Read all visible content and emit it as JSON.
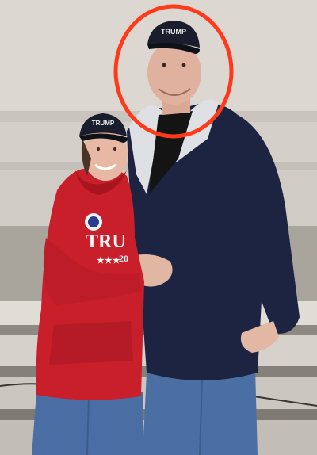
{
  "photo": {
    "hoodie_print": "TRU",
    "hoodie_year": "20",
    "cap_text_left": "TRUMP",
    "cap_text_right": "TRUMP"
  },
  "colors": {
    "wall": "#d8d4cd",
    "steps": "#bdb8b0",
    "red_hoodie": "#c8202a",
    "navy_hoodie": "#1c2340",
    "jeans": "#4a6fa5",
    "circle": "#ff3a1a",
    "cap": "#1a1d2b"
  }
}
